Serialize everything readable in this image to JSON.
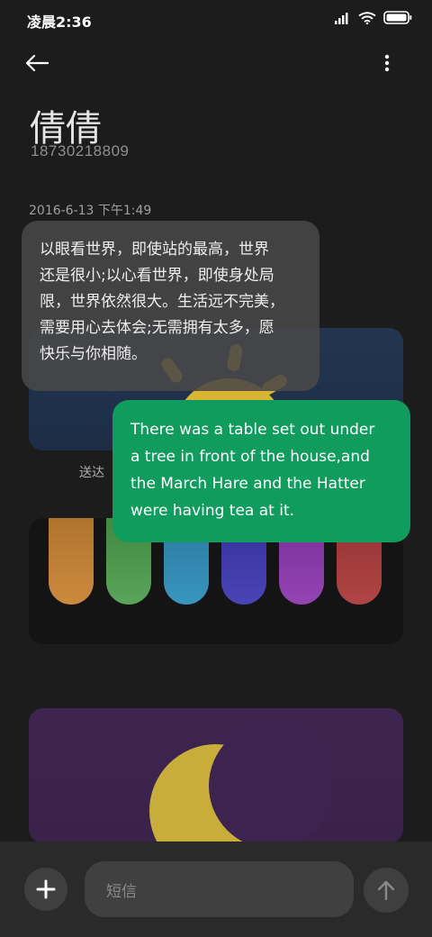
{
  "status": {
    "time": "凌晨2:36",
    "icons": [
      "signal-icon",
      "wifi-icon",
      "battery-icon"
    ]
  },
  "toolbar": {
    "back_icon": "back-arrow-icon",
    "more_icon": "more-vert-icon"
  },
  "contact": {
    "name": "倩倩",
    "number": "18730218809"
  },
  "thread": {
    "timestamp": "2016-6-13 下午1:49",
    "incoming": {
      "lines": [
        "以眼看世界，即使站的最高，世界",
        "还是很小;以心看世界，即使身处局",
        "限，世界依然很大。生活远不完美，",
        "需要用心去体会;无需拥有太多，愿",
        "快乐与你相随。"
      ]
    },
    "sent_label": "送达",
    "outgoing": {
      "lines": [
        "There was a table set out under",
        "a tree in front of the house,and",
        "the March Hare and the Hatter",
        "were having tea at it."
      ]
    }
  },
  "composer": {
    "placeholder": "短信",
    "add_icon": "plus-icon",
    "send_icon": "send-arrow-icon"
  },
  "colors": {
    "background": "#1c1c1c",
    "outgoing_bubble": "#0f9c5c",
    "incoming_bubble": "#484848",
    "bottom_bar": "#2a2a2a",
    "tube_colors": [
      "#c98534",
      "#4e9a4c",
      "#2f88b0",
      "#3e3aa8",
      "#8a3aa8",
      "#a83a3a"
    ]
  }
}
